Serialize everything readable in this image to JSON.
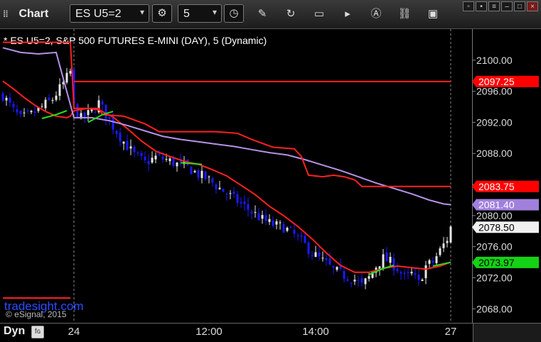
{
  "toolbar": {
    "title": "Chart",
    "symbol": "ES U5=2",
    "interval": "5"
  },
  "chart_title": "* ES U5=2, S&P 500 FUTURES E-MINI (DAY), 5 (Dynamic)",
  "watermark": "tradesight.com",
  "copyright": "© eSignal, 2015",
  "footer": {
    "dyn_label": "Dyn",
    "x_labels": [
      {
        "text": "24",
        "slot": 20
      },
      {
        "text": "12:00",
        "slot": 58
      },
      {
        "text": "14:00",
        "slot": 88
      },
      {
        "text": "27",
        "slot": 126
      }
    ]
  },
  "colors": {
    "background": "#000000",
    "up_candle": "#e6e6e6",
    "down_candle": "#1a1aff",
    "red_line": "#ff2020",
    "purple_line": "#b493e6",
    "green_line": "#20e020",
    "price_tag_red": "#ff0000",
    "price_tag_purple": "#a080dc",
    "price_tag_green": "#14d214",
    "price_tag_white": "#f0f0f0"
  },
  "chart_data": {
    "type": "candlestick",
    "title": "* ES U5=2, S&P 500 FUTURES E-MINI (DAY), 5 (Dynamic)",
    "ylim": [
      2066.2,
      2104.0
    ],
    "y_ticks": [
      2068,
      2072,
      2076,
      2080,
      2084,
      2088,
      2092,
      2096,
      2100
    ],
    "y_tick_labels": [
      "2068.00",
      "2072.00",
      "2076.00",
      "2080.00",
      "2084.00",
      "2088.00",
      "2092.00",
      "2096.00",
      "2100.00"
    ],
    "slots": 127,
    "session_break_slot": 20,
    "close_path": [
      [
        0,
        2095.5
      ],
      [
        3,
        2093.5
      ],
      [
        5,
        2092.5
      ],
      [
        8,
        2093.0
      ],
      [
        11,
        2094.0
      ],
      [
        14,
        2095.0
      ],
      [
        17,
        2097.0
      ],
      [
        19,
        2098.5
      ],
      [
        20,
        2094.0
      ],
      [
        22,
        2092.5
      ],
      [
        25,
        2093.3
      ],
      [
        27,
        2094.5
      ],
      [
        29,
        2093.0
      ],
      [
        31,
        2091.5
      ],
      [
        34,
        2089.5
      ],
      [
        37,
        2087.8
      ],
      [
        40,
        2086.8
      ],
      [
        43,
        2087.5
      ],
      [
        46,
        2087.2
      ],
      [
        49,
        2086.6
      ],
      [
        52,
        2086.2
      ],
      [
        55,
        2085.3
      ],
      [
        58,
        2084.6
      ],
      [
        61,
        2083.5
      ],
      [
        64,
        2082.5
      ],
      [
        67,
        2081.5
      ],
      [
        70,
        2080.5
      ],
      [
        73,
        2079.5
      ],
      [
        76,
        2078.8
      ],
      [
        79,
        2078.5
      ],
      [
        82,
        2077.5
      ],
      [
        85,
        2076.2
      ],
      [
        87,
        2075.2
      ],
      [
        89,
        2074.5
      ],
      [
        91,
        2073.8
      ],
      [
        93,
        2073.0
      ],
      [
        96,
        2072.3
      ],
      [
        99,
        2071.8
      ],
      [
        101,
        2071.0
      ],
      [
        103,
        2072.0
      ],
      [
        105,
        2073.5
      ],
      [
        107,
        2074.5
      ],
      [
        109,
        2074.0
      ],
      [
        111,
        2073.2
      ],
      [
        113,
        2072.0
      ],
      [
        115,
        2072.5
      ],
      [
        117,
        2071.3
      ],
      [
        119,
        2073.5
      ],
      [
        121,
        2074.0
      ],
      [
        123,
        2075.5
      ],
      [
        125,
        2077.0
      ],
      [
        126,
        2078.5
      ]
    ],
    "series": [
      {
        "color_key": "red_line",
        "points": [
          [
            0,
            2097.3
          ],
          [
            3,
            2096.3
          ],
          [
            6,
            2095.2
          ],
          [
            9,
            2094.2
          ],
          [
            12,
            2093.4
          ],
          [
            15,
            2092.8
          ],
          [
            18,
            2092.6
          ],
          [
            19,
            2092.8
          ],
          [
            20,
            2093.5
          ],
          [
            24,
            2093.8
          ],
          [
            27,
            2093.6
          ],
          [
            31,
            2092.7
          ],
          [
            35,
            2091.2
          ],
          [
            39,
            2089.6
          ],
          [
            43,
            2088.3
          ],
          [
            47,
            2087.6
          ],
          [
            51,
            2087.0
          ],
          [
            55,
            2086.6
          ],
          [
            59,
            2085.9
          ],
          [
            63,
            2085.1
          ],
          [
            67,
            2083.9
          ],
          [
            71,
            2082.7
          ],
          [
            75,
            2081.2
          ],
          [
            79,
            2080.0
          ],
          [
            83,
            2078.6
          ],
          [
            87,
            2077.0
          ],
          [
            91,
            2075.2
          ],
          [
            95,
            2073.6
          ],
          [
            99,
            2072.7
          ],
          [
            103,
            2072.7
          ],
          [
            107,
            2073.2
          ],
          [
            111,
            2073.5
          ],
          [
            115,
            2073.3
          ],
          [
            119,
            2073.1
          ],
          [
            123,
            2073.5
          ],
          [
            126,
            2074.0
          ]
        ]
      },
      {
        "color_key": "purple_line",
        "points": [
          [
            0,
            2101.6
          ],
          [
            5,
            2101.0
          ],
          [
            10,
            2100.8
          ],
          [
            15,
            2101.0
          ],
          [
            20,
            2092.6
          ],
          [
            25,
            2092.6
          ],
          [
            30,
            2092.2
          ],
          [
            35,
            2091.6
          ],
          [
            40,
            2090.9
          ],
          [
            45,
            2090.2
          ],
          [
            50,
            2089.8
          ],
          [
            55,
            2089.5
          ],
          [
            60,
            2089.2
          ],
          [
            65,
            2088.9
          ],
          [
            70,
            2088.5
          ],
          [
            75,
            2088.1
          ],
          [
            80,
            2087.8
          ],
          [
            85,
            2087.2
          ],
          [
            90,
            2086.5
          ],
          [
            95,
            2085.8
          ],
          [
            100,
            2085.0
          ],
          [
            105,
            2084.2
          ],
          [
            110,
            2083.5
          ],
          [
            115,
            2082.8
          ],
          [
            120,
            2082.0
          ],
          [
            124,
            2081.5
          ],
          [
            126,
            2081.4
          ]
        ]
      },
      {
        "color_key": "red_line",
        "points": [
          [
            0,
            2102.3
          ],
          [
            19,
            2102.3
          ],
          [
            20,
            2094.0
          ],
          [
            20,
            2093.8
          ],
          [
            27,
            2093.8
          ],
          [
            28,
            2093.0
          ],
          [
            34,
            2092.8
          ],
          [
            40,
            2091.8
          ],
          [
            44,
            2090.8
          ],
          [
            60,
            2090.8
          ],
          [
            66,
            2090.6
          ],
          [
            70,
            2089.8
          ],
          [
            76,
            2088.8
          ],
          [
            82,
            2088.6
          ],
          [
            84,
            2087.6
          ],
          [
            86,
            2085.2
          ],
          [
            90,
            2085.0
          ],
          [
            93,
            2085.2
          ],
          [
            96,
            2085.0
          ],
          [
            99,
            2084.6
          ],
          [
            101,
            2083.75
          ],
          [
            126,
            2083.75
          ]
        ]
      },
      {
        "color_key": "red_line",
        "points": [
          [
            20,
            2097.25
          ],
          [
            126,
            2097.25
          ]
        ]
      },
      {
        "color_key": "red_line",
        "points": [
          [
            0,
            2069.4
          ],
          [
            19,
            2069.4
          ]
        ]
      },
      {
        "color_key": "green_line",
        "points": [
          [
            11,
            2092.5
          ],
          [
            15,
            2093.0
          ],
          [
            18,
            2093.5
          ]
        ]
      },
      {
        "color_key": "green_line",
        "points": [
          [
            24,
            2092.0
          ],
          [
            28,
            2093.0
          ],
          [
            31,
            2093.4
          ]
        ]
      },
      {
        "color_key": "green_line",
        "points": [
          [
            50,
            2086.8
          ],
          [
            56,
            2086.6
          ]
        ]
      },
      {
        "color_key": "green_line",
        "points": [
          [
            103,
            2072.4
          ],
          [
            107,
            2073.2
          ],
          [
            110,
            2073.6
          ]
        ]
      },
      {
        "color_key": "green_line",
        "points": [
          [
            121,
            2073.5
          ],
          [
            124,
            2073.8
          ],
          [
            126,
            2074.0
          ]
        ]
      }
    ],
    "price_tags": [
      {
        "value": 2097.25,
        "label": "2097.25",
        "color_key": "price_tag_red",
        "text": "#ffffff"
      },
      {
        "value": 2083.75,
        "label": "2083.75",
        "color_key": "price_tag_red",
        "text": "#ffffff"
      },
      {
        "value": 2081.4,
        "label": "2081.40",
        "color_key": "price_tag_purple",
        "text": "#ffffff"
      },
      {
        "value": 2078.5,
        "label": "2078.50",
        "color_key": "price_tag_white",
        "text": "#000000"
      },
      {
        "value": 2073.97,
        "label": "2073.97",
        "color_key": "price_tag_green",
        "text": "#000000"
      }
    ]
  }
}
